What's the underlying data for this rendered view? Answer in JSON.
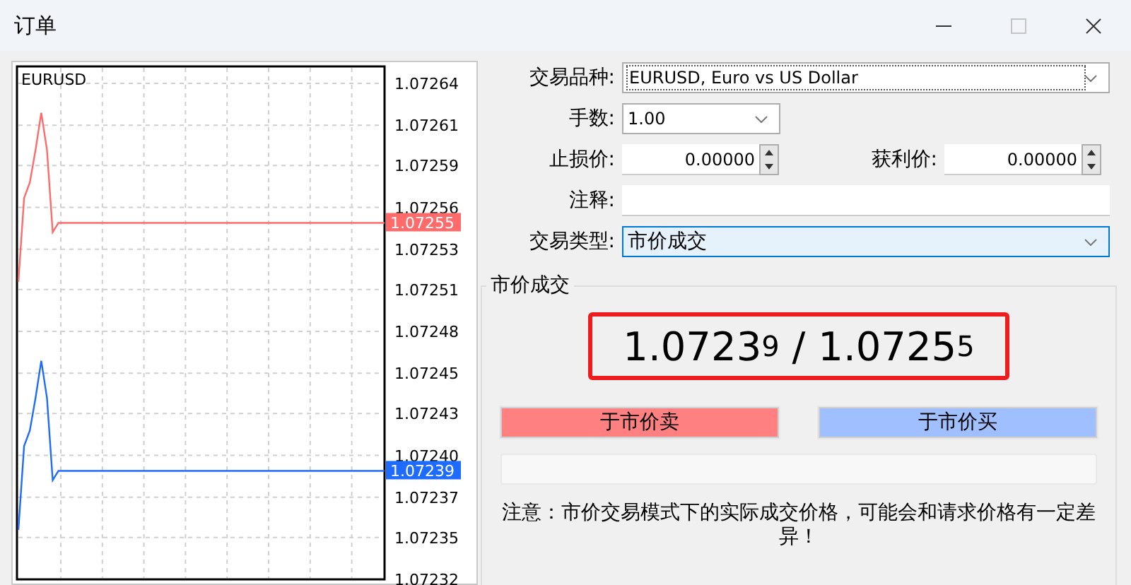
{
  "window": {
    "title": "订单",
    "controls": [
      {
        "kind": "minimize",
        "disabled": false
      },
      {
        "kind": "maximize",
        "disabled": true
      },
      {
        "kind": "close",
        "disabled": false
      }
    ]
  },
  "chart": {
    "chart_data": {
      "type": "line",
      "title": "EURUSD",
      "grid": true,
      "categories": [
        null,
        null,
        null,
        null,
        null,
        null,
        null,
        null,
        null,
        null,
        null,
        null,
        null,
        null,
        null,
        null,
        null,
        null,
        null,
        null,
        null,
        null,
        null,
        null,
        null,
        null,
        null,
        null,
        null,
        null,
        null,
        null,
        null,
        null,
        null,
        null,
        null,
        null,
        null,
        null,
        null,
        null,
        null,
        null,
        null,
        null,
        null,
        null,
        null,
        null,
        null,
        null,
        null,
        null,
        null,
        null,
        null,
        null,
        null,
        null,
        null,
        null,
        null,
        null,
        null
      ],
      "ylim": [
        1.07232,
        1.07264
      ],
      "yticks": [
        {
          "value": 1.07264,
          "label": "1.07264"
        },
        {
          "value": 1.072613,
          "label": "1.07261"
        },
        {
          "value": 1.072587,
          "label": "1.07259"
        },
        {
          "value": 1.07256,
          "label": "1.07256"
        },
        {
          "value": 1.072533,
          "label": "1.07253"
        },
        {
          "value": 1.072507,
          "label": "1.07251"
        },
        {
          "value": 1.07248,
          "label": "1.07248"
        },
        {
          "value": 1.072453,
          "label": "1.07245"
        },
        {
          "value": 1.072427,
          "label": "1.07243"
        },
        {
          "value": 1.0724,
          "label": "1.07240"
        },
        {
          "value": 1.072373,
          "label": "1.07237"
        },
        {
          "value": 1.072347,
          "label": "1.07235"
        },
        {
          "value": 1.07232,
          "label": "1.07232"
        }
      ],
      "series": [
        {
          "color": "#ff6b6b",
          "values": [
            1.072512,
            1.072566,
            1.072576,
            1.072597,
            1.072621,
            1.072597,
            1.072544,
            1.07255,
            1.07255,
            1.07255,
            1.07255,
            1.07255,
            1.07255,
            1.07255,
            1.07255,
            1.07255,
            1.07255,
            1.07255,
            1.07255,
            1.07255,
            1.07255,
            1.07255,
            1.07255,
            1.07255,
            1.07255,
            1.07255,
            1.07255,
            1.07255,
            1.07255,
            1.07255,
            1.07255,
            1.07255,
            1.07255,
            1.07255,
            1.07255,
            1.07255,
            1.07255,
            1.07255,
            1.07255,
            1.07255,
            1.07255,
            1.07255,
            1.07255,
            1.07255,
            1.07255,
            1.07255,
            1.07255,
            1.07255,
            1.07255,
            1.07255,
            1.07255,
            1.07255,
            1.07255,
            1.07255,
            1.07255,
            1.07255,
            1.07255,
            1.07255,
            1.07255,
            1.07255,
            1.07255,
            1.07255,
            1.07255,
            1.07255,
            1.07255
          ]
        },
        {
          "color": "#1e6bff",
          "values": [
            1.072352,
            1.072406,
            1.072416,
            1.072437,
            1.072461,
            1.072437,
            1.072384,
            1.07239,
            1.07239,
            1.07239,
            1.07239,
            1.07239,
            1.07239,
            1.07239,
            1.07239,
            1.07239,
            1.07239,
            1.07239,
            1.07239,
            1.07239,
            1.07239,
            1.07239,
            1.07239,
            1.07239,
            1.07239,
            1.07239,
            1.07239,
            1.07239,
            1.07239,
            1.07239,
            1.07239,
            1.07239,
            1.07239,
            1.07239,
            1.07239,
            1.07239,
            1.07239,
            1.07239,
            1.07239,
            1.07239,
            1.07239,
            1.07239,
            1.07239,
            1.07239,
            1.07239,
            1.07239,
            1.07239,
            1.07239,
            1.07239,
            1.07239,
            1.07239,
            1.07239,
            1.07239,
            1.07239,
            1.07239,
            1.07239,
            1.07239,
            1.07239,
            1.07239,
            1.07239,
            1.07239,
            1.07239,
            1.07239,
            1.07239,
            1.07239
          ]
        }
      ]
    },
    "ask_tag": "1.07255",
    "bid_tag": "1.07239"
  },
  "form": {
    "symbol": {
      "label": "交易品种:",
      "value": "EURUSD, Euro vs US Dollar"
    },
    "volume": {
      "label": "手数:",
      "value": "1.00"
    },
    "stop_loss": {
      "label": "止损价:",
      "value": "0.00000"
    },
    "take_profit": {
      "label": "获利价:",
      "value": "0.00000"
    },
    "comment": {
      "label": "注释:"
    },
    "order_type": {
      "label": "交易类型:",
      "value": "市价成交"
    }
  },
  "market": {
    "title": "市价成交",
    "bid": {
      "main": "1.0723",
      "pip": "9"
    },
    "separator": "/",
    "ask": {
      "main": "1.0725",
      "pip": "5"
    },
    "sell_button": "于市价卖",
    "buy_button": "于市价买",
    "notice": "注意：市价交易模式下的实际成交价格，可能会和请求价格有一定差异！"
  }
}
